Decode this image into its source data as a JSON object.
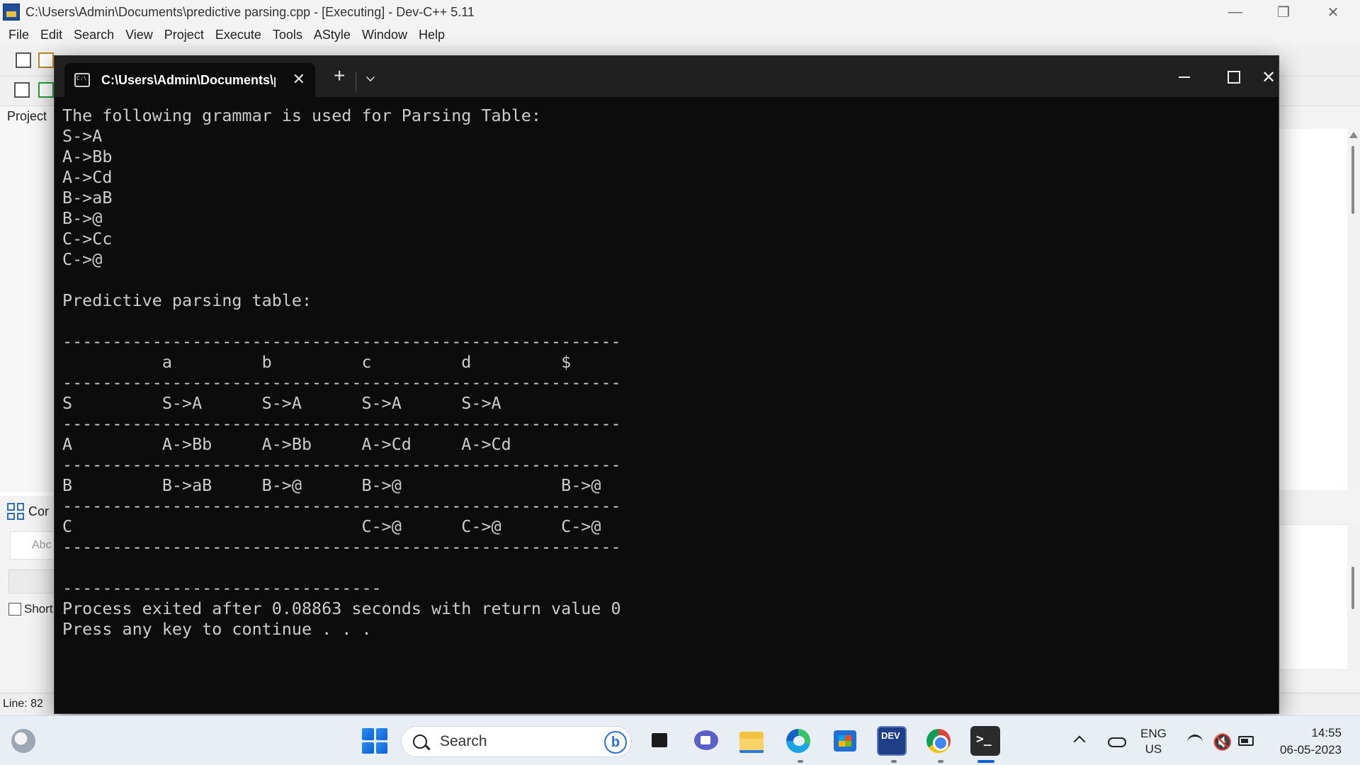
{
  "devcpp": {
    "title": "C:\\Users\\Admin\\Documents\\predictive parsing.cpp - [Executing] - Dev-C++ 5.11",
    "menu": [
      "File",
      "Edit",
      "Search",
      "View",
      "Project",
      "Execute",
      "Tools",
      "AStyle",
      "Window",
      "Help"
    ],
    "project_tab": "Project",
    "compiler_tab": "Cor",
    "abc_placeholder": "Abc",
    "short_label": "Short",
    "status_line": "Line:   82"
  },
  "terminal": {
    "tab_title": "C:\\Users\\Admin\\Documents\\predictive parsing",
    "lines": [
      "The following grammar is used for Parsing Table:",
      "S->A",
      "A->Bb",
      "A->Cd",
      "B->aB",
      "B->@",
      "C->Cc",
      "C->@",
      "",
      "Predictive parsing table:",
      "",
      "--------------------------------------------------------",
      "          a         b         c         d         $",
      "--------------------------------------------------------",
      "S         S->A      S->A      S->A      S->A",
      "--------------------------------------------------------",
      "A         A->Bb     A->Bb     A->Cd     A->Cd",
      "--------------------------------------------------------",
      "B         B->aB     B->@      B->@                B->@",
      "--------------------------------------------------------",
      "C                             C->@      C->@      C->@",
      "--------------------------------------------------------",
      "",
      "--------------------------------",
      "Process exited after 0.08863 seconds with return value 0",
      "Press any key to continue . . ."
    ]
  },
  "taskbar": {
    "search_label": "Search",
    "bing_label": "b",
    "devcpp_label": "DEV",
    "terminal_glyph": ">_",
    "lang_line1": "ENG",
    "lang_line2": "US",
    "time": "14:55",
    "date": "06-05-2023"
  },
  "icons": [
    "windows-start-icon",
    "search-icon",
    "bing-icon",
    "task-view-icon",
    "chat-icon",
    "file-explorer-icon",
    "edge-icon",
    "store-icon",
    "devcpp-icon",
    "chrome-icon",
    "terminal-icon",
    "chevron-up-icon",
    "onedrive-icon",
    "wifi-icon",
    "volume-muted-icon",
    "battery-icon"
  ]
}
